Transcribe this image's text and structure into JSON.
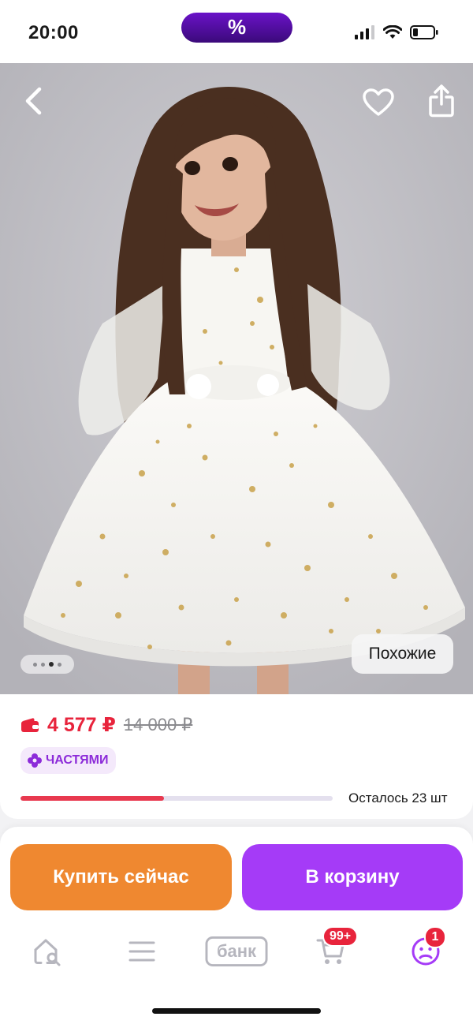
{
  "status_bar": {
    "time": "20:00",
    "promo_symbol": "%"
  },
  "hero": {
    "carousel_total": 4,
    "carousel_active_index": 2,
    "similar_label": "Похожие"
  },
  "product": {
    "price_current": "4 577 ₽",
    "price_old": "14 000 ₽",
    "installments_label": "ЧАСТЯМИ",
    "stock_fraction": 0.46,
    "stock_label": "Осталось 23 шт"
  },
  "actions": {
    "buy_now_label": "Купить сейчас",
    "add_to_cart_label": "В корзину"
  },
  "tabbar": {
    "bank_label": "банк",
    "cart_badge": "99+",
    "profile_badge": "1"
  },
  "colors": {
    "price_red": "#e8243c",
    "buy_now_orange": "#ef8830",
    "cart_purple": "#a53bf7",
    "promo_purple": "#4b0c9a"
  }
}
